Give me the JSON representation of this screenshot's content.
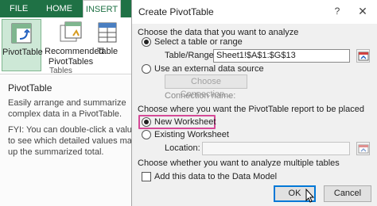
{
  "ribbon": {
    "tabs": [
      "FILE",
      "HOME",
      "INSERT"
    ],
    "buttons": {
      "pivot": "PivotTable",
      "recommended": "Recommended PivotTables",
      "table": "Table"
    },
    "group_label": "Tables"
  },
  "tooltip": {
    "title": "PivotTable",
    "description": "Easily arrange and summarize complex data in a PivotTable.",
    "fyi": "FYI: You can double-click a value to see which detailed values make up the summarized total."
  },
  "dialog": {
    "title": "Create PivotTable",
    "help": "?",
    "close": "✕",
    "section_data": "Choose the data that you want to analyze",
    "opt_select_table": "Select a table or range",
    "table_range_label": "Table/Range:",
    "table_range_value": "Sheet1!$A$1:$G$13",
    "opt_external": "Use an external data source",
    "choose_connection": "Choose Connection...",
    "connection_name_label": "Connection name:",
    "section_placement": "Choose where you want the PivotTable report to be placed",
    "opt_new_worksheet": "New Worksheet",
    "opt_existing_worksheet": "Existing Worksheet",
    "location_label": "Location:",
    "location_value": "",
    "section_multiple": "Choose whether you want to analyze multiple tables",
    "add_data_model": "Add this data to the Data Model",
    "ok": "OK",
    "cancel": "Cancel"
  },
  "colors": {
    "excel_green": "#1f7145",
    "highlight": "#d54a97"
  }
}
